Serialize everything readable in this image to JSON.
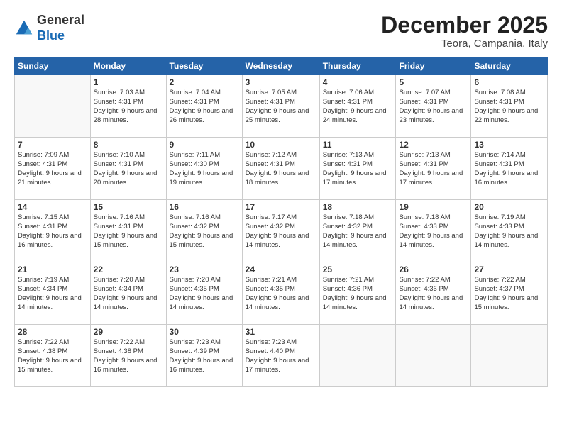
{
  "header": {
    "logo_line1": "General",
    "logo_line2": "Blue",
    "month": "December 2025",
    "location": "Teora, Campania, Italy"
  },
  "weekdays": [
    "Sunday",
    "Monday",
    "Tuesday",
    "Wednesday",
    "Thursday",
    "Friday",
    "Saturday"
  ],
  "weeks": [
    [
      {
        "day": "",
        "info": ""
      },
      {
        "day": "1",
        "info": "Sunrise: 7:03 AM\nSunset: 4:31 PM\nDaylight: 9 hours\nand 28 minutes."
      },
      {
        "day": "2",
        "info": "Sunrise: 7:04 AM\nSunset: 4:31 PM\nDaylight: 9 hours\nand 26 minutes."
      },
      {
        "day": "3",
        "info": "Sunrise: 7:05 AM\nSunset: 4:31 PM\nDaylight: 9 hours\nand 25 minutes."
      },
      {
        "day": "4",
        "info": "Sunrise: 7:06 AM\nSunset: 4:31 PM\nDaylight: 9 hours\nand 24 minutes."
      },
      {
        "day": "5",
        "info": "Sunrise: 7:07 AM\nSunset: 4:31 PM\nDaylight: 9 hours\nand 23 minutes."
      },
      {
        "day": "6",
        "info": "Sunrise: 7:08 AM\nSunset: 4:31 PM\nDaylight: 9 hours\nand 22 minutes."
      }
    ],
    [
      {
        "day": "7",
        "info": "Sunrise: 7:09 AM\nSunset: 4:31 PM\nDaylight: 9 hours\nand 21 minutes."
      },
      {
        "day": "8",
        "info": "Sunrise: 7:10 AM\nSunset: 4:31 PM\nDaylight: 9 hours\nand 20 minutes."
      },
      {
        "day": "9",
        "info": "Sunrise: 7:11 AM\nSunset: 4:30 PM\nDaylight: 9 hours\nand 19 minutes."
      },
      {
        "day": "10",
        "info": "Sunrise: 7:12 AM\nSunset: 4:31 PM\nDaylight: 9 hours\nand 18 minutes."
      },
      {
        "day": "11",
        "info": "Sunrise: 7:13 AM\nSunset: 4:31 PM\nDaylight: 9 hours\nand 17 minutes."
      },
      {
        "day": "12",
        "info": "Sunrise: 7:13 AM\nSunset: 4:31 PM\nDaylight: 9 hours\nand 17 minutes."
      },
      {
        "day": "13",
        "info": "Sunrise: 7:14 AM\nSunset: 4:31 PM\nDaylight: 9 hours\nand 16 minutes."
      }
    ],
    [
      {
        "day": "14",
        "info": "Sunrise: 7:15 AM\nSunset: 4:31 PM\nDaylight: 9 hours\nand 16 minutes."
      },
      {
        "day": "15",
        "info": "Sunrise: 7:16 AM\nSunset: 4:31 PM\nDaylight: 9 hours\nand 15 minutes."
      },
      {
        "day": "16",
        "info": "Sunrise: 7:16 AM\nSunset: 4:32 PM\nDaylight: 9 hours\nand 15 minutes."
      },
      {
        "day": "17",
        "info": "Sunrise: 7:17 AM\nSunset: 4:32 PM\nDaylight: 9 hours\nand 14 minutes."
      },
      {
        "day": "18",
        "info": "Sunrise: 7:18 AM\nSunset: 4:32 PM\nDaylight: 9 hours\nand 14 minutes."
      },
      {
        "day": "19",
        "info": "Sunrise: 7:18 AM\nSunset: 4:33 PM\nDaylight: 9 hours\nand 14 minutes."
      },
      {
        "day": "20",
        "info": "Sunrise: 7:19 AM\nSunset: 4:33 PM\nDaylight: 9 hours\nand 14 minutes."
      }
    ],
    [
      {
        "day": "21",
        "info": "Sunrise: 7:19 AM\nSunset: 4:34 PM\nDaylight: 9 hours\nand 14 minutes."
      },
      {
        "day": "22",
        "info": "Sunrise: 7:20 AM\nSunset: 4:34 PM\nDaylight: 9 hours\nand 14 minutes."
      },
      {
        "day": "23",
        "info": "Sunrise: 7:20 AM\nSunset: 4:35 PM\nDaylight: 9 hours\nand 14 minutes."
      },
      {
        "day": "24",
        "info": "Sunrise: 7:21 AM\nSunset: 4:35 PM\nDaylight: 9 hours\nand 14 minutes."
      },
      {
        "day": "25",
        "info": "Sunrise: 7:21 AM\nSunset: 4:36 PM\nDaylight: 9 hours\nand 14 minutes."
      },
      {
        "day": "26",
        "info": "Sunrise: 7:22 AM\nSunset: 4:36 PM\nDaylight: 9 hours\nand 14 minutes."
      },
      {
        "day": "27",
        "info": "Sunrise: 7:22 AM\nSunset: 4:37 PM\nDaylight: 9 hours\nand 15 minutes."
      }
    ],
    [
      {
        "day": "28",
        "info": "Sunrise: 7:22 AM\nSunset: 4:38 PM\nDaylight: 9 hours\nand 15 minutes."
      },
      {
        "day": "29",
        "info": "Sunrise: 7:22 AM\nSunset: 4:38 PM\nDaylight: 9 hours\nand 16 minutes."
      },
      {
        "day": "30",
        "info": "Sunrise: 7:23 AM\nSunset: 4:39 PM\nDaylight: 9 hours\nand 16 minutes."
      },
      {
        "day": "31",
        "info": "Sunrise: 7:23 AM\nSunset: 4:40 PM\nDaylight: 9 hours\nand 17 minutes."
      },
      {
        "day": "",
        "info": ""
      },
      {
        "day": "",
        "info": ""
      },
      {
        "day": "",
        "info": ""
      }
    ]
  ]
}
